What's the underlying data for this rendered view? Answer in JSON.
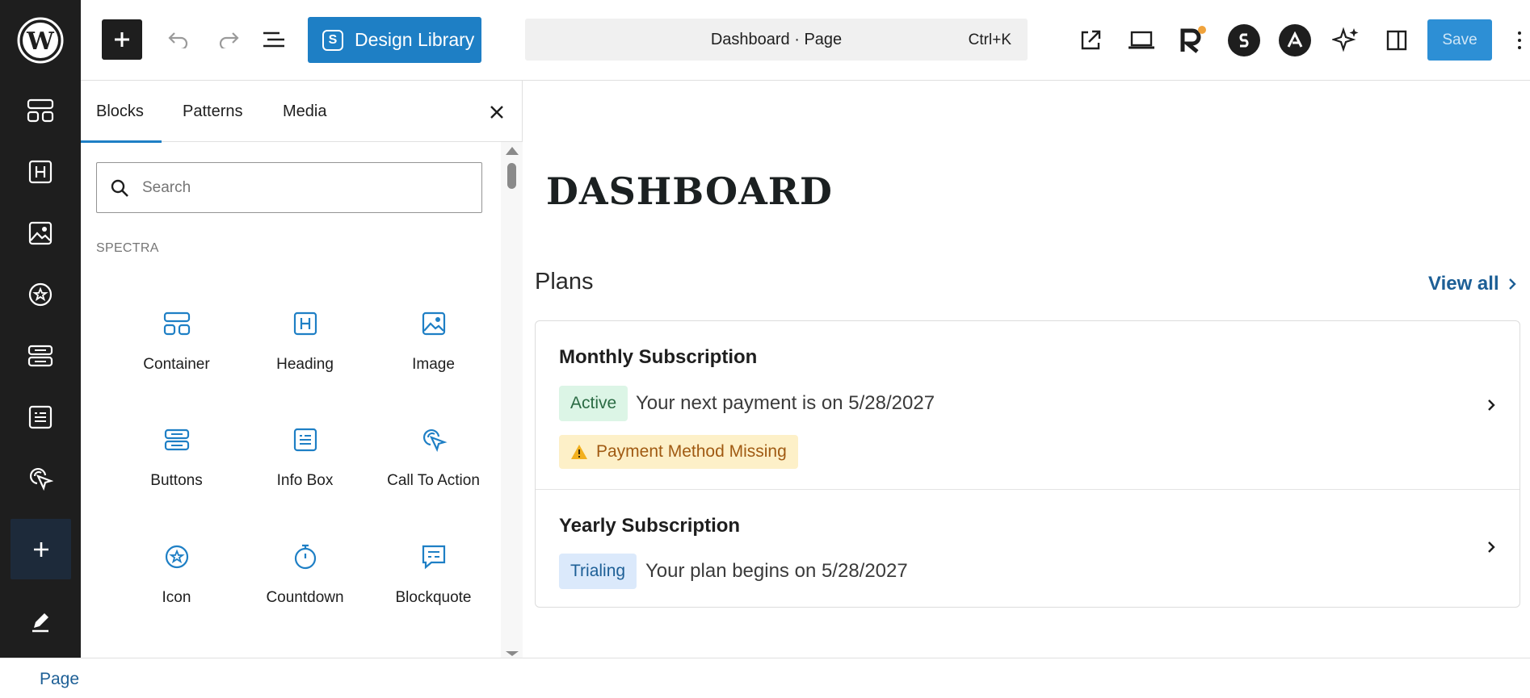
{
  "topbar": {
    "toggle_inserter_label": "Toggle block inserter",
    "design_library_label": "Design Library",
    "command": {
      "title": "Dashboard · Page",
      "shortcut": "Ctrl+K"
    },
    "save_label": "Save"
  },
  "panel": {
    "tabs": [
      {
        "label": "Blocks",
        "active": true
      },
      {
        "label": "Patterns",
        "active": false
      },
      {
        "label": "Media",
        "active": false
      }
    ],
    "search_placeholder": "Search",
    "category": "SPECTRA",
    "blocks": [
      {
        "label": "Container",
        "icon": "container-icon"
      },
      {
        "label": "Heading",
        "icon": "heading-icon"
      },
      {
        "label": "Image",
        "icon": "image-icon"
      },
      {
        "label": "Buttons",
        "icon": "buttons-icon"
      },
      {
        "label": "Info Box",
        "icon": "info-box-icon"
      },
      {
        "label": "Call To Action",
        "icon": "call-to-action-icon"
      },
      {
        "label": "Icon",
        "icon": "star-circle-icon"
      },
      {
        "label": "Countdown",
        "icon": "stopwatch-icon"
      },
      {
        "label": "Blockquote",
        "icon": "quote-bubble-icon"
      }
    ]
  },
  "canvas": {
    "page_heading": "DASHBOARD",
    "plans_title": "Plans",
    "view_all": "View all",
    "plans": [
      {
        "name": "Monthly Subscription",
        "status": "Active",
        "description": "Your next payment is on 5/28/2027",
        "warning": "Payment Method Missing"
      },
      {
        "name": "Yearly Subscription",
        "status": "Trialing",
        "description": "Your plan begins on 5/28/2027"
      }
    ]
  },
  "footer": {
    "breadcrumb": "Page"
  },
  "colors": {
    "accent": "#1e7fc5",
    "link": "#1d5f96",
    "rail": "#1e1e1e",
    "active_badge": "#dcf5e6",
    "trial_badge": "#dbe9fb",
    "warning_badge": "#fdf0c8"
  }
}
